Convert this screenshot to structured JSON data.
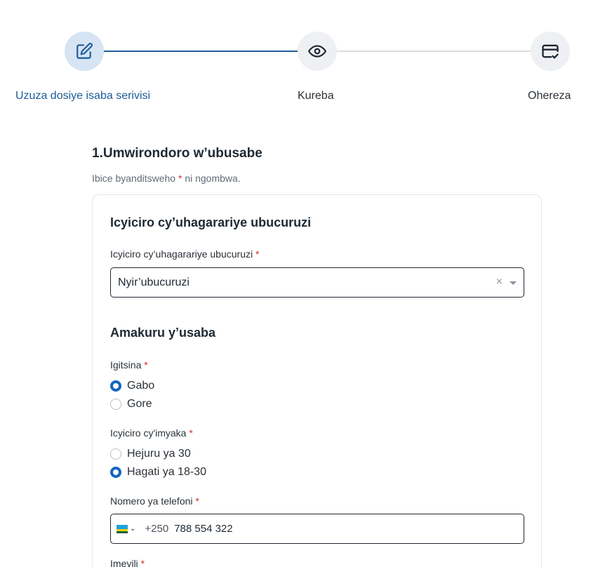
{
  "stepper": {
    "steps": [
      {
        "label": "Uzuza dosiye isaba serivisi",
        "icon": "edit-icon",
        "state": "active"
      },
      {
        "label": "Kureba",
        "icon": "eye-icon",
        "state": "pending"
      },
      {
        "label": "Ohereza",
        "icon": "card-check-icon",
        "state": "pending"
      }
    ]
  },
  "section": {
    "title": "1.Umwirondoro w’ubusabe",
    "note_prefix": "Ibice byanditsweho",
    "note_star": "*",
    "note_suffix": "ni ngombwa."
  },
  "card": {
    "heading_category": "Icyiciro cy’uhagarariye ubucuruzi",
    "category_field": {
      "label": "Icyiciro cy’uhagarariye ubucuruzi",
      "required": "*",
      "value": "Nyir’ubucuruzi",
      "clear": "×"
    },
    "heading_applicant": "Amakuru y’usaba",
    "gender": {
      "label": "Igitsina",
      "required": "*",
      "options": [
        {
          "label": "Gabo",
          "checked": true
        },
        {
          "label": "Gore",
          "checked": false
        }
      ]
    },
    "age": {
      "label": "Icyiciro cy'imyaka",
      "required": "*",
      "options": [
        {
          "label": "Hejuru ya 30",
          "checked": false
        },
        {
          "label": "Hagati ya 18-30",
          "checked": true
        }
      ]
    },
    "phone": {
      "label": "Nomero ya telefoni",
      "required": "*",
      "dial_code": "+250",
      "value": "788 554 322",
      "chevron": "⌄"
    },
    "email": {
      "label": "Imeyili",
      "required": "*"
    }
  },
  "colors": {
    "accent": "#1e5d9a",
    "radio_checked": "#1565c0",
    "required": "#d32f2f"
  }
}
